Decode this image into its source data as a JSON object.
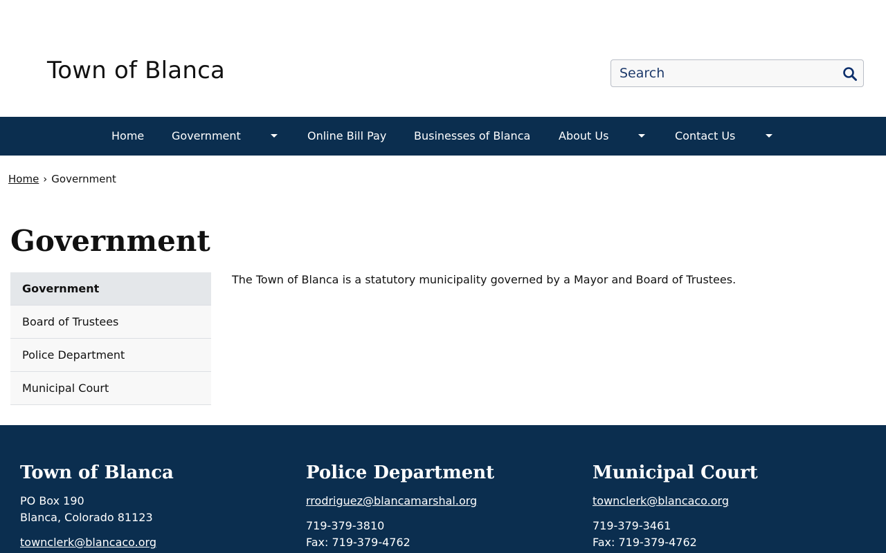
{
  "header": {
    "site_title": "Town of Blanca",
    "search_placeholder": "Search"
  },
  "nav": {
    "items": [
      {
        "label": "Home"
      },
      {
        "label": "Government"
      },
      {
        "label": "Online Bill Pay"
      },
      {
        "label": "Businesses of Blanca"
      },
      {
        "label": "About Us"
      },
      {
        "label": "Contact Us"
      }
    ]
  },
  "breadcrumb": {
    "home": "Home",
    "separator": "›",
    "current": "Government"
  },
  "page": {
    "title": "Government",
    "body": "The Town of Blanca is a statutory municipality governed by a Mayor and Board of Trustees."
  },
  "sidenav": {
    "items": [
      {
        "label": "Government"
      },
      {
        "label": "Board of Trustees"
      },
      {
        "label": "Police Department"
      },
      {
        "label": "Municipal Court"
      }
    ]
  },
  "footer": {
    "town": {
      "title": "Town of Blanca",
      "address_line1": "PO Box 190",
      "address_line2": "Blanca, Colorado 81123",
      "email": "townclerk@blancaco.org"
    },
    "police": {
      "title": "Police Department",
      "email": "rrodriguez@blancamarshal.org",
      "phone": "719-379-3810",
      "fax": "Fax: 719-379-4762"
    },
    "court": {
      "title": "Municipal Court",
      "email": "townclerk@blancaco.org",
      "phone": "719-379-3461",
      "fax": "Fax: 719-379-4762"
    }
  },
  "colors": {
    "nav_background": "#0b2e4f",
    "footer_background": "#0b2e4f",
    "search_text": "#1d3a6b"
  }
}
